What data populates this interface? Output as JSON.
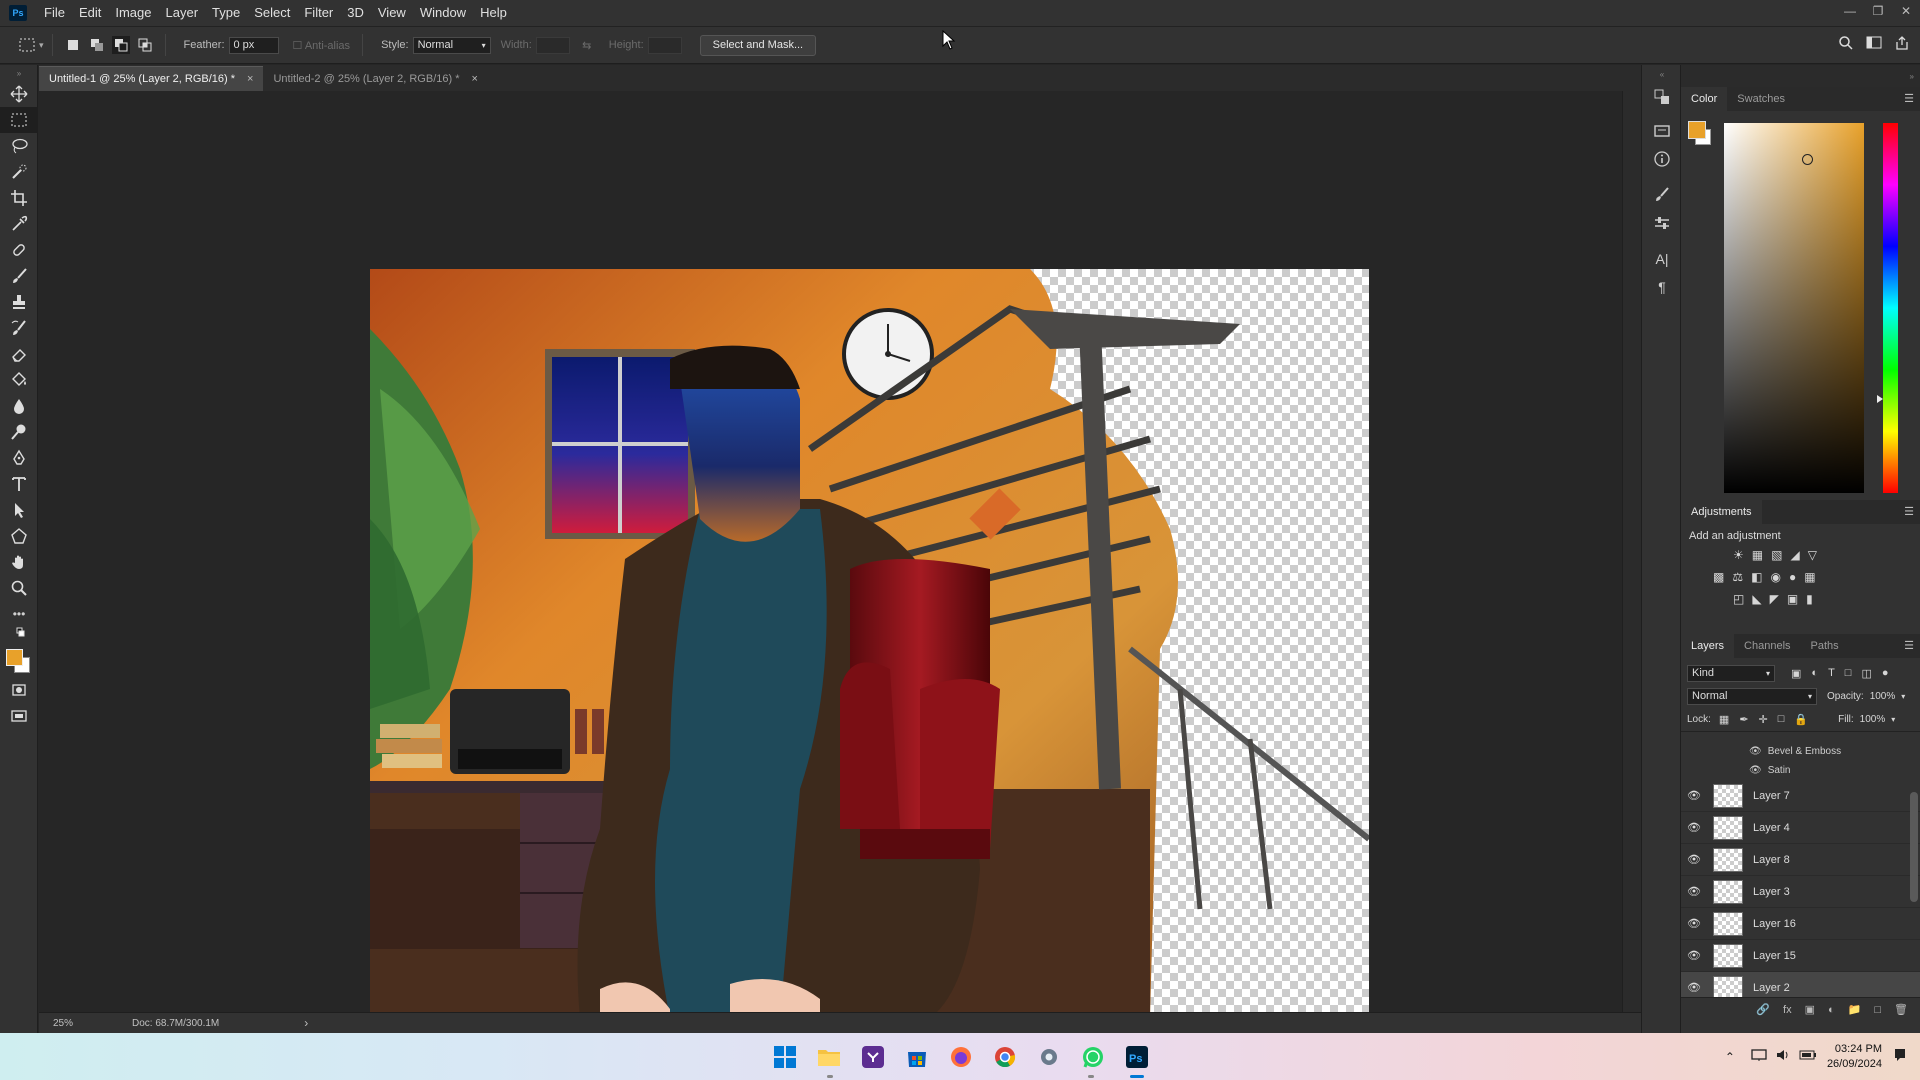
{
  "app": {
    "logo_text": "Ps"
  },
  "menu": [
    "File",
    "Edit",
    "Image",
    "Layer",
    "Type",
    "Select",
    "Filter",
    "3D",
    "View",
    "Window",
    "Help"
  ],
  "options": {
    "feather_label": "Feather:",
    "feather_value": "0 px",
    "antialias_label": "Anti-alias",
    "style_label": "Style:",
    "style_value": "Normal",
    "width_label": "Width:",
    "height_label": "Height:",
    "select_mask_button": "Select and Mask..."
  },
  "tabs": [
    {
      "label": "Untitled-1 @ 25% (Layer 2, RGB/16) *",
      "close": "×"
    },
    {
      "label": "Untitled-2 @ 25% (Layer 2, RGB/16) *",
      "close": "×"
    }
  ],
  "status": {
    "zoom": "25%",
    "doc": "Doc: 68.7M/300.1M",
    "arrow": "›"
  },
  "color_panel": {
    "tabs": [
      "Color",
      "Swatches"
    ],
    "foreground": "#e8a12a",
    "background": "#ffffff"
  },
  "adjustments": {
    "title": "Adjustments",
    "subtitle": "Add an adjustment"
  },
  "layers_panel": {
    "tabs": [
      "Layers",
      "Channels",
      "Paths"
    ],
    "filter_kind": "Kind",
    "blend_mode": "Normal",
    "opacity_label": "Opacity:",
    "opacity_value": "100%",
    "lock_label": "Lock:",
    "fill_label": "Fill:",
    "fill_value": "100%",
    "effects": [
      "Bevel & Emboss",
      "Satin"
    ],
    "layers": [
      {
        "name": "Layer 7",
        "selected": false
      },
      {
        "name": "Layer 4",
        "selected": false
      },
      {
        "name": "Layer 8",
        "selected": false
      },
      {
        "name": "Layer 3",
        "selected": false
      },
      {
        "name": "Layer 16",
        "selected": false
      },
      {
        "name": "Layer 15",
        "selected": false
      },
      {
        "name": "Layer 2",
        "selected": true
      }
    ]
  },
  "taskbar": {
    "time": "03:24 PM",
    "date": "26/09/2024",
    "apps": [
      "windows-start",
      "file-explorer",
      "visual-studio",
      "microsoft-store",
      "firefox",
      "chrome",
      "settings",
      "whatsapp",
      "photoshop"
    ]
  }
}
